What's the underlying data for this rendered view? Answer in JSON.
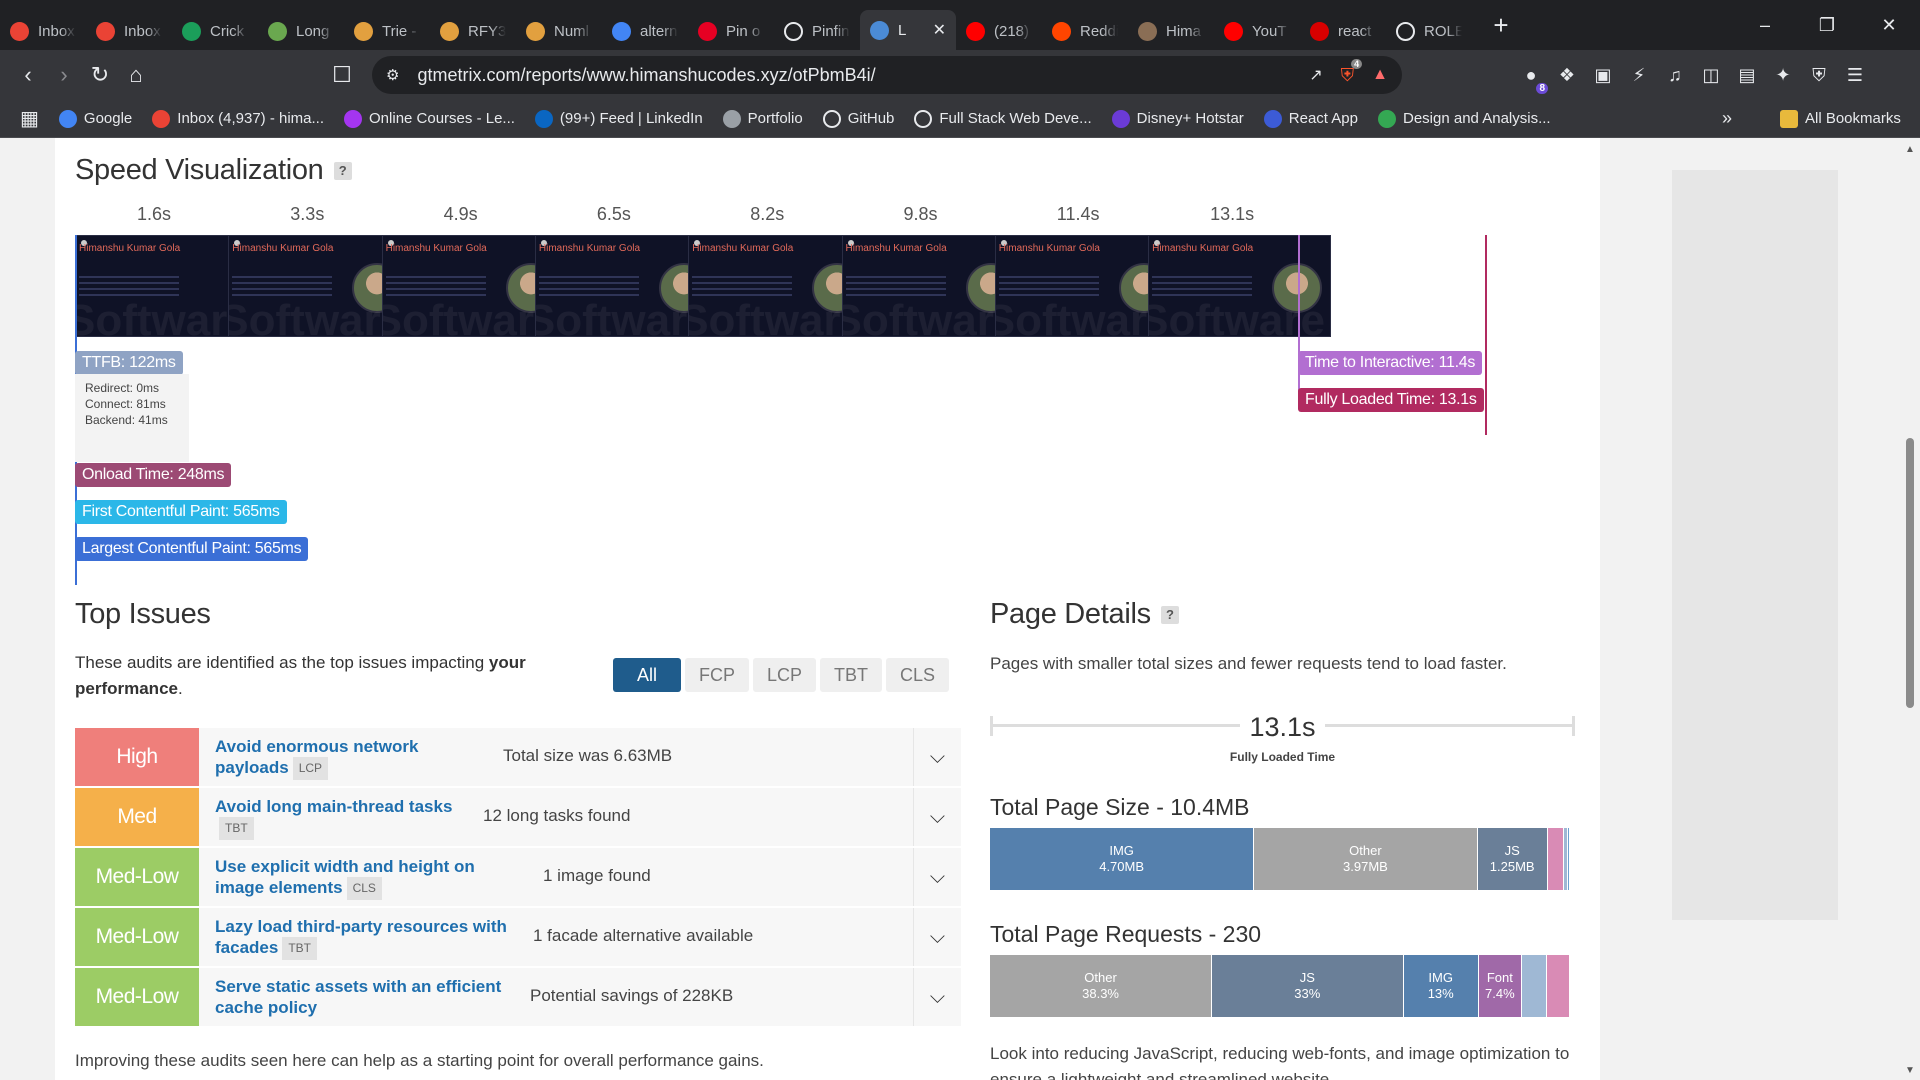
{
  "browser": {
    "tabs": [
      {
        "title": "Inbox",
        "icon": "gmail-icon",
        "color": "#ea4335"
      },
      {
        "title": "Inbox",
        "icon": "gmail-icon",
        "color": "#ea4335"
      },
      {
        "title": "Crick",
        "icon": "cricbuzz-icon",
        "color": "#1b9e5a"
      },
      {
        "title": "Long",
        "icon": "leetcode-icon",
        "color": "#6aa84f"
      },
      {
        "title": "Trie -",
        "icon": "code-icon",
        "color": "#e2a03f"
      },
      {
        "title": "RFY3",
        "icon": "code-icon",
        "color": "#e2a03f"
      },
      {
        "title": "Numl",
        "icon": "code-icon",
        "color": "#e2a03f"
      },
      {
        "title": "altern",
        "icon": "google-icon",
        "color": "#4285f4"
      },
      {
        "title": "Pin o",
        "icon": "pinterest-icon",
        "color": "#e60023"
      },
      {
        "title": "Pinfin",
        "icon": "github-icon",
        "color": "#ffffff"
      },
      {
        "title": "L",
        "icon": "gtmetrix-icon",
        "color": "#4b8bd6",
        "active": true
      },
      {
        "title": "(218)",
        "icon": "youtube-icon",
        "color": "#ff0000"
      },
      {
        "title": "Reddi",
        "icon": "reddit-icon",
        "color": "#ff4500"
      },
      {
        "title": "Hima",
        "icon": "image-icon",
        "color": "#8a6e55"
      },
      {
        "title": "YouT",
        "icon": "youtube-icon",
        "color": "#ff0000"
      },
      {
        "title": "react",
        "icon": "news-icon",
        "color": "#d80000"
      },
      {
        "title": "ROLE",
        "icon": "github-icon",
        "color": "#ffffff"
      }
    ],
    "url": "gtmetrix.com/reports/www.himanshucodes.xyz/otPbmB4i/",
    "brave_badge": "4",
    "ext_badge": "8",
    "bookmarks": [
      {
        "label": "Google",
        "icon": "google-icon",
        "color": "#4285f4"
      },
      {
        "label": "Inbox (4,937) - hima...",
        "icon": "gmail-icon",
        "color": "#ea4335"
      },
      {
        "label": "Online Courses - Le...",
        "icon": "udemy-icon",
        "color": "#a435f0"
      },
      {
        "label": "(99+) Feed | LinkedIn",
        "icon": "linkedin-icon",
        "color": "#0a66c2"
      },
      {
        "label": "Portfolio",
        "icon": "globe-icon",
        "color": "#9aa0a6"
      },
      {
        "label": "GitHub",
        "icon": "github-icon",
        "color": "#ffffff"
      },
      {
        "label": "Full Stack Web Deve...",
        "icon": "page-icon",
        "color": "#ffffff"
      },
      {
        "label": "Disney+ Hotstar",
        "icon": "hotstar-icon",
        "color": "#6b3bd6"
      },
      {
        "label": "React App",
        "icon": "react-icon",
        "color": "#3c5bd6"
      },
      {
        "label": "Design and Analysis...",
        "icon": "doc-icon",
        "color": "#34a853"
      }
    ],
    "all_bookmarks": "All Bookmarks"
  },
  "speed": {
    "title": "Speed Visualization",
    "help": "?",
    "ticks": [
      "1.6s",
      "3.3s",
      "4.9s",
      "6.5s",
      "8.2s",
      "9.8s",
      "11.4s",
      "13.1s"
    ],
    "frame_heading": "Himanshu Kumar Gola",
    "frame_watermark": "Software Engineer",
    "ttfb": {
      "label": "TTFB: 122ms",
      "redirect": "Redirect: 0ms",
      "connect": "Connect: 81ms",
      "backend": "Backend: 41ms"
    },
    "markers": [
      {
        "label": "Onload Time: 248ms",
        "color": "#9c4a74"
      },
      {
        "label": "First Contentful Paint: 565ms",
        "color": "#2bb7e8"
      },
      {
        "label": "Largest Contentful Paint: 565ms",
        "color": "#3b6fd6"
      },
      {
        "label": "Time to Interactive: 11.4s",
        "color": "#b26fd1"
      },
      {
        "label": "Fully Loaded Time: 13.1s",
        "color": "#b12a60"
      }
    ]
  },
  "issues": {
    "title": "Top Issues",
    "desc_pre": "These audits are identified as the top issues impacting ",
    "desc_bold": "your performance",
    "desc_post": ".",
    "filters": [
      "All",
      "FCP",
      "LCP",
      "TBT",
      "CLS"
    ],
    "items": [
      {
        "severity": "High",
        "color": "#ef7f7b",
        "title": "Avoid enormous network payloads",
        "tag": "LCP",
        "detail": "Total size was 6.63MB"
      },
      {
        "severity": "Med",
        "color": "#f5b04a",
        "title": "Avoid long main-thread tasks",
        "tag": "TBT",
        "detail": "12 long tasks found"
      },
      {
        "severity": "Med-Low",
        "color": "#9ccc65",
        "title": "Use explicit width and height on image elements",
        "tag": "CLS",
        "detail": "1 image found"
      },
      {
        "severity": "Med-Low",
        "color": "#9ccc65",
        "title": "Lazy load third-party resources with facades",
        "tag": "TBT",
        "detail": "1 facade alternative available"
      },
      {
        "severity": "Med-Low",
        "color": "#9ccc65",
        "title": "Serve static assets with an efficient cache policy",
        "tag": "",
        "detail": "Potential savings of 228KB"
      }
    ],
    "footer": "Improving these audits seen here can help as a starting point for overall performance gains."
  },
  "details": {
    "title": "Page Details",
    "help": "?",
    "desc": "Pages with smaller total sizes and fewer requests tend to load faster.",
    "fully_loaded_value": "13.1s",
    "fully_loaded_label": "Fully Loaded Time",
    "size_title": "Total Page Size - 10.4MB",
    "size_segments": [
      {
        "label": "IMG",
        "value": "4.70MB",
        "share": 45.2,
        "color": "#5580ad"
      },
      {
        "label": "Other",
        "value": "3.97MB",
        "share": 38.2,
        "color": "#a5a5a5"
      },
      {
        "label": "JS",
        "value": "1.25MB",
        "share": 12.0,
        "color": "#6a7f98"
      },
      {
        "label": "",
        "value": "",
        "share": 2.8,
        "color": "#d98bb5"
      },
      {
        "label": "",
        "value": "",
        "share": 0.6,
        "color": "#9fb8d4"
      },
      {
        "label": "",
        "value": "",
        "share": 0.4,
        "color": "#6da0d0"
      }
    ],
    "req_title": "Total Page Requests - 230",
    "req_segments": [
      {
        "label": "Other",
        "value": "38.3%",
        "share": 38.3,
        "color": "#a5a5a5"
      },
      {
        "label": "JS",
        "value": "33%",
        "share": 33,
        "color": "#6a7f98"
      },
      {
        "label": "IMG",
        "value": "13%",
        "share": 13,
        "color": "#5580ad"
      },
      {
        "label": "Font",
        "value": "7.4%",
        "share": 7.4,
        "color": "#a069a8"
      },
      {
        "label": "",
        "value": "",
        "share": 4.3,
        "color": "#9fb8d4"
      },
      {
        "label": "",
        "value": "",
        "share": 4.0,
        "color": "#d98bb5"
      }
    ],
    "footer": "Look into reducing JavaScript, reducing web-fonts, and image optimization to ensure a lightweight and streamlined website."
  }
}
